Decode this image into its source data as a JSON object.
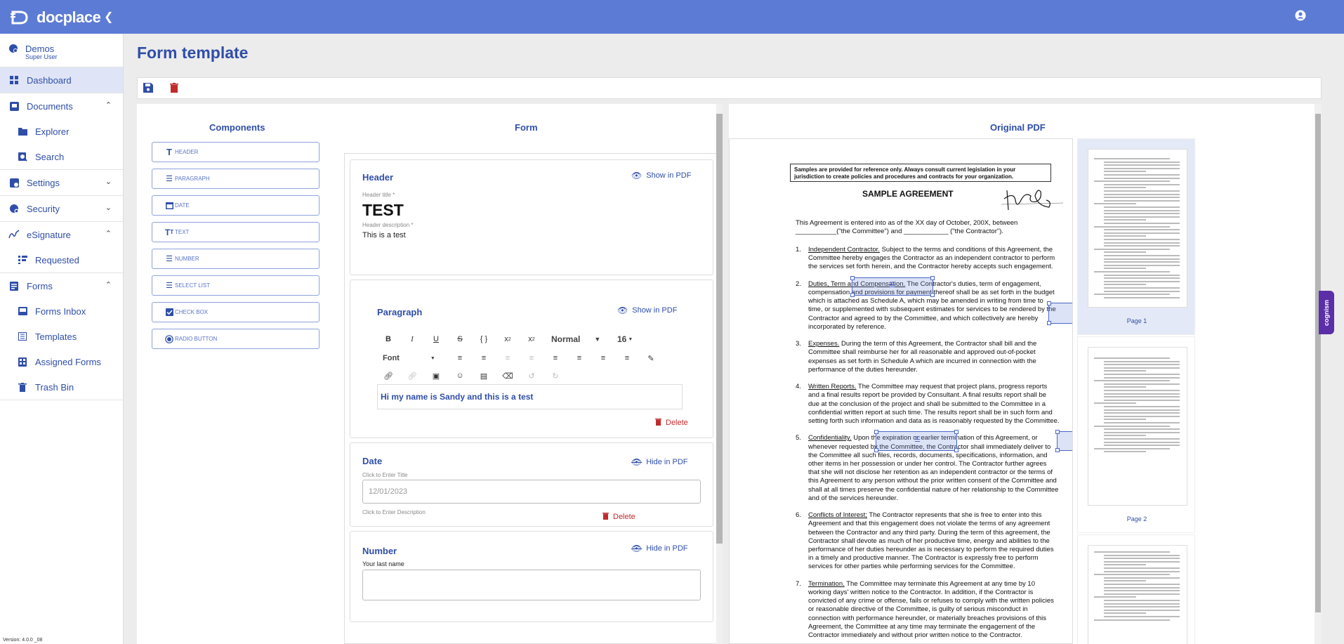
{
  "app": {
    "logo_text": "docplace"
  },
  "sidebar": {
    "user": {
      "name": "Demos",
      "role": "Super User"
    },
    "items": [
      {
        "label": "Dashboard"
      },
      {
        "label": "Documents"
      },
      {
        "label": "Explorer"
      },
      {
        "label": "Search"
      },
      {
        "label": "Settings"
      },
      {
        "label": "Security"
      },
      {
        "label": "eSignature"
      },
      {
        "label": "Requested"
      },
      {
        "label": "Forms"
      },
      {
        "label": "Forms Inbox"
      },
      {
        "label": "Templates"
      },
      {
        "label": "Assigned Forms"
      },
      {
        "label": "Trash Bin"
      }
    ],
    "version": "Version: 4.0.0 _08"
  },
  "page": {
    "title": "Form template"
  },
  "columns": {
    "components": "Components",
    "form": "Form",
    "original_pdf": "Original PDF"
  },
  "components": [
    "HEADER",
    "PARAGRAPH",
    "DATE",
    "TEXT",
    "NUMBER",
    "SELECT LIST",
    "CHECK BOX",
    "RADIO BUTTON"
  ],
  "form": {
    "header": {
      "card_title": "Header",
      "pdf_toggle": "Show in PDF",
      "title_label": "Header title *",
      "title_value": "TEST",
      "desc_label": "Header description *",
      "desc_value": "This is a test"
    },
    "paragraph": {
      "card_title": "Paragraph",
      "pdf_toggle": "Show in PDF",
      "style_select": "Normal",
      "size_select": "16",
      "font_select": "Font",
      "content": "Hi my name is Sandy and this is a test",
      "delete": "Delete"
    },
    "date": {
      "card_title": "Date",
      "pdf_toggle": "Hide in PDF",
      "title_placeholder": "Click to Enter Title",
      "value": "12/01/2023",
      "desc_placeholder": "Click to Enter Description",
      "delete": "Delete"
    },
    "number": {
      "card_title": "Number",
      "pdf_toggle": "Hide in PDF",
      "field_label": "Your last name"
    }
  },
  "pdf": {
    "notice": "Samples are provided for reference only.  Always consult current legislation in your jurisdiction to create policies and procedures and contracts for your organization.",
    "heading": "SAMPLE AGREEMENT",
    "intro_1": "This Agreement is entered into as of the XX day of October, 200X, between",
    "intro_2": "___________(\"the Committee\") and ____________ (\"the Contractor\").",
    "sections": [
      {
        "num": "1.",
        "title": "Independent Contractor.",
        "lines": [
          "Subject to the terms and conditions of this Agreement, the",
          "Committee hereby engages the Contractor as an independent contractor to perform",
          "the services set forth herein, and the Contractor hereby accepts such engagement."
        ]
      },
      {
        "num": "2.",
        "title": "Duties, Term and Compensation.",
        "lines": [
          "The Contractor's duties, term of engagement,",
          "compensation and provisions for payment thereof shall be as set forth in the budget",
          "which is attached as Schedule A, which may be amended in writing from time to",
          "time, or supplemented with subsequent estimates for services to be rendered by the",
          "Contractor and agreed to by the Committee, and which collectively are hereby",
          "incorporated by reference."
        ]
      },
      {
        "num": "3.",
        "title": "Expenses.",
        "lines": [
          "During the term of this Agreement, the Contractor shall bill and the",
          "Committee shall reimburse her for all reasonable and approved out-of-pocket",
          "expenses as set forth in Schedule A which are incurred in connection with the",
          "performance of the duties hereunder."
        ]
      },
      {
        "num": "4.",
        "title": "Written Reports.",
        "lines": [
          "The Committee may request that project plans, progress reports",
          "and a final results report be provided by Consultant.  A final results report shall be",
          "due at the conclusion of the project and shall be submitted to the Committee in a",
          "confidential written report at such time. The results report shall be in such form and",
          "setting forth such information and data as is reasonably requested by the Committee."
        ]
      },
      {
        "num": "5.",
        "title": "Confidentiality.",
        "lines": [
          "Upon the expiration or earlier termination of this Agreement, or",
          "whenever requested by the Committee, the Contractor shall immediately deliver to",
          "the Committee all such files, records, documents, specifications, information, and",
          "other items in her possession or under her control.  The Contractor further agrees",
          "that she will not disclose her retention as an independent contractor or the terms of",
          "this Agreement to any person without the prior written consent of the Committee and",
          "shall at all times preserve the confidential nature of her relationship to the Committee",
          "and of the services hereunder."
        ]
      },
      {
        "num": "6.",
        "title": "Conflicts of Interest;",
        "lines": [
          "The Contractor represents that she is free to enter into this",
          "Agreement and that this engagement does not violate the terms of any agreement",
          "between the Contractor and any third party.  During the term of this agreement, the",
          "Contractor shall devote as much of her productive time, energy and abilities to the",
          "performance of her duties hereunder as is necessary to perform the required duties",
          "in a timely and productive manner.  The Contractor is expressly free to perform",
          "services for other parties while performing services for the Committee."
        ]
      },
      {
        "num": "7.",
        "title": "Termination.",
        "lines": [
          "The Committee may terminate this Agreement at any time by 10",
          "working days' written notice to the Contractor.  In addition, if the Contractor is",
          "convicted of any crime or offense, fails or refuses to comply with the written policies",
          "or reasonable directive of the Committee, is guilty of serious misconduct in",
          "connection with performance hereunder, or materially breaches provisions of this",
          "Agreement, the Committee at any time may terminate the engagement of the",
          "Contractor immediately and without prior written notice to the Contractor."
        ]
      }
    ],
    "thumbs": [
      {
        "label": "Page 1"
      },
      {
        "label": "Page 2"
      }
    ]
  },
  "widget": {
    "label": "cognism"
  },
  "colors": {
    "brand": "#5c7bd5",
    "accent": "#2f4ea8",
    "danger": "#c02b2b",
    "widget": "#5b2fa8"
  }
}
